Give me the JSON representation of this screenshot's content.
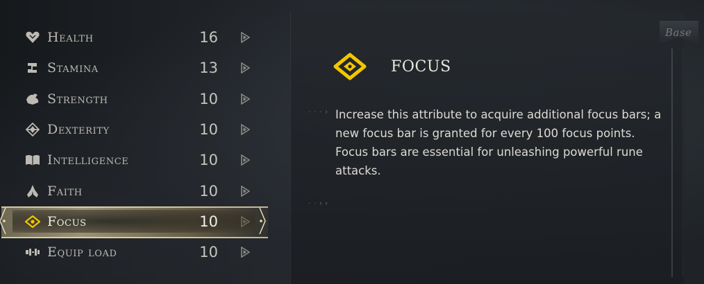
{
  "attributes": [
    {
      "name": "Health",
      "value": "16",
      "icon": "heart-icon"
    },
    {
      "name": "Stamina",
      "value": "13",
      "icon": "stamina-icon"
    },
    {
      "name": "Strength",
      "value": "10",
      "icon": "strength-icon"
    },
    {
      "name": "Dexterity",
      "value": "10",
      "icon": "dexterity-icon"
    },
    {
      "name": "Intelligence",
      "value": "10",
      "icon": "book-icon"
    },
    {
      "name": "Faith",
      "value": "10",
      "icon": "praying-hands-icon"
    },
    {
      "name": "Focus",
      "value": "10",
      "icon": "focus-eye-icon"
    },
    {
      "name": "Equip Load",
      "value": "10",
      "icon": "equip-load-icon"
    }
  ],
  "selected_index": 6,
  "detail": {
    "title": "FOCUS",
    "description": "Increase this attribute to acquire additional focus bars; a new focus bar is granted for every 100 focus points. Focus bars are essential for unleashing powerful rune attacks.",
    "icon": "focus-eye-icon"
  },
  "base_tab": "Base",
  "colors": {
    "accent_yellow": "#f2c600",
    "text": "#c9c6bf",
    "background": "#1b1e22"
  }
}
